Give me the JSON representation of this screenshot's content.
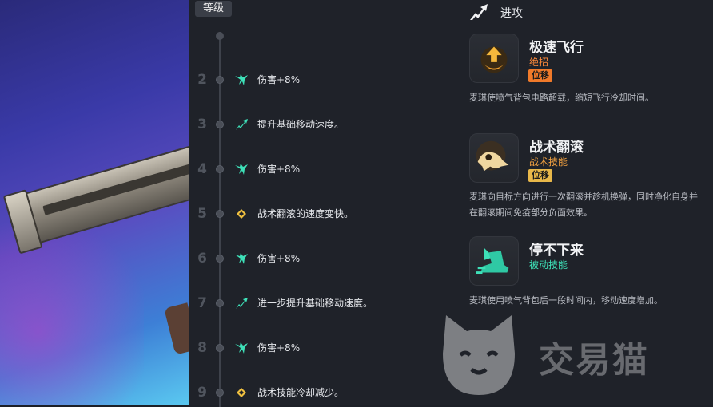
{
  "levels": {
    "header": "等级",
    "rows": [
      {
        "level": "2",
        "icon": "wing-icon",
        "text": "伤害+8%"
      },
      {
        "level": "3",
        "icon": "arrow-up-right-icon",
        "text": "提升基础移动速度。"
      },
      {
        "level": "4",
        "icon": "wing-icon",
        "text": "伤害+8%"
      },
      {
        "level": "5",
        "icon": "diamond-icon",
        "text": "战术翻滚的速度变快。"
      },
      {
        "level": "6",
        "icon": "wing-icon",
        "text": "伤害+8%"
      },
      {
        "level": "7",
        "icon": "arrow-up-right-icon",
        "text": "进一步提升基础移动速度。"
      },
      {
        "level": "8",
        "icon": "wing-icon",
        "text": "伤害+8%"
      },
      {
        "level": "9",
        "icon": "diamond-icon",
        "text": "战术技能冷却减少。"
      }
    ]
  },
  "section": {
    "icon": "attack-arrow-icon",
    "title": "进攻"
  },
  "abilities": [
    {
      "name": "极速飞行",
      "type": "绝招",
      "type_color": "#ff8a3a",
      "tag": "位移",
      "tag_color": "#f07a2a",
      "description": [
        "麦琪使喷气背包电路超载，缩短飞行冷却时间。"
      ]
    },
    {
      "name": "战术翻滚",
      "type": "战术技能",
      "type_color": "#f0a040",
      "tag": "位移",
      "tag_color": "#e8b84a",
      "description": [
        "麦琪向目标方向进行一次翻滚并趁机换弹，同时净化自身并",
        "在翻滚期间免疫部分负面效果。"
      ]
    },
    {
      "name": "停不下来",
      "type": "被动技能",
      "type_color": "#3ee0b8",
      "tag": "",
      "description": [
        "麦琪使用喷气背包后一段时间内，移动速度增加。"
      ]
    }
  ],
  "watermark": {
    "text": "交易猫"
  },
  "colors": {
    "accent_teal": "#3ee0b8",
    "accent_orange": "#ff8a3a",
    "diamond_yellow": "#f0c040"
  }
}
